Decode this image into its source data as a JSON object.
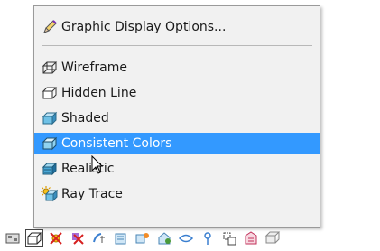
{
  "menu": {
    "options_label": "Graphic Display Options...",
    "items": [
      {
        "label": "Wireframe",
        "icon": "wireframe-cube-icon"
      },
      {
        "label": "Hidden Line",
        "icon": "hidden-line-cube-icon"
      },
      {
        "label": "Shaded",
        "icon": "shaded-cube-icon"
      },
      {
        "label": "Consistent Colors",
        "icon": "consistent-colors-cube-icon",
        "selected": true
      },
      {
        "label": "Realistic",
        "icon": "realistic-cube-icon"
      },
      {
        "label": "Ray Trace",
        "icon": "ray-trace-icon"
      }
    ]
  },
  "toolbar": {
    "icons": [
      "scale-icon",
      "visual-style-icon",
      "sun-path-icon",
      "shadows-icon",
      "crop-view-icon",
      "show-crop-icon",
      "temporary-hide-icon",
      "reveal-hidden-icon",
      "worksets-icon",
      "analytical-model-icon",
      "highlight-displacement-icon",
      "reveal-constraints-icon",
      "rendering-icon"
    ]
  },
  "colors": {
    "selection": "#3399ff",
    "menu_bg": "#f1f1f1"
  }
}
